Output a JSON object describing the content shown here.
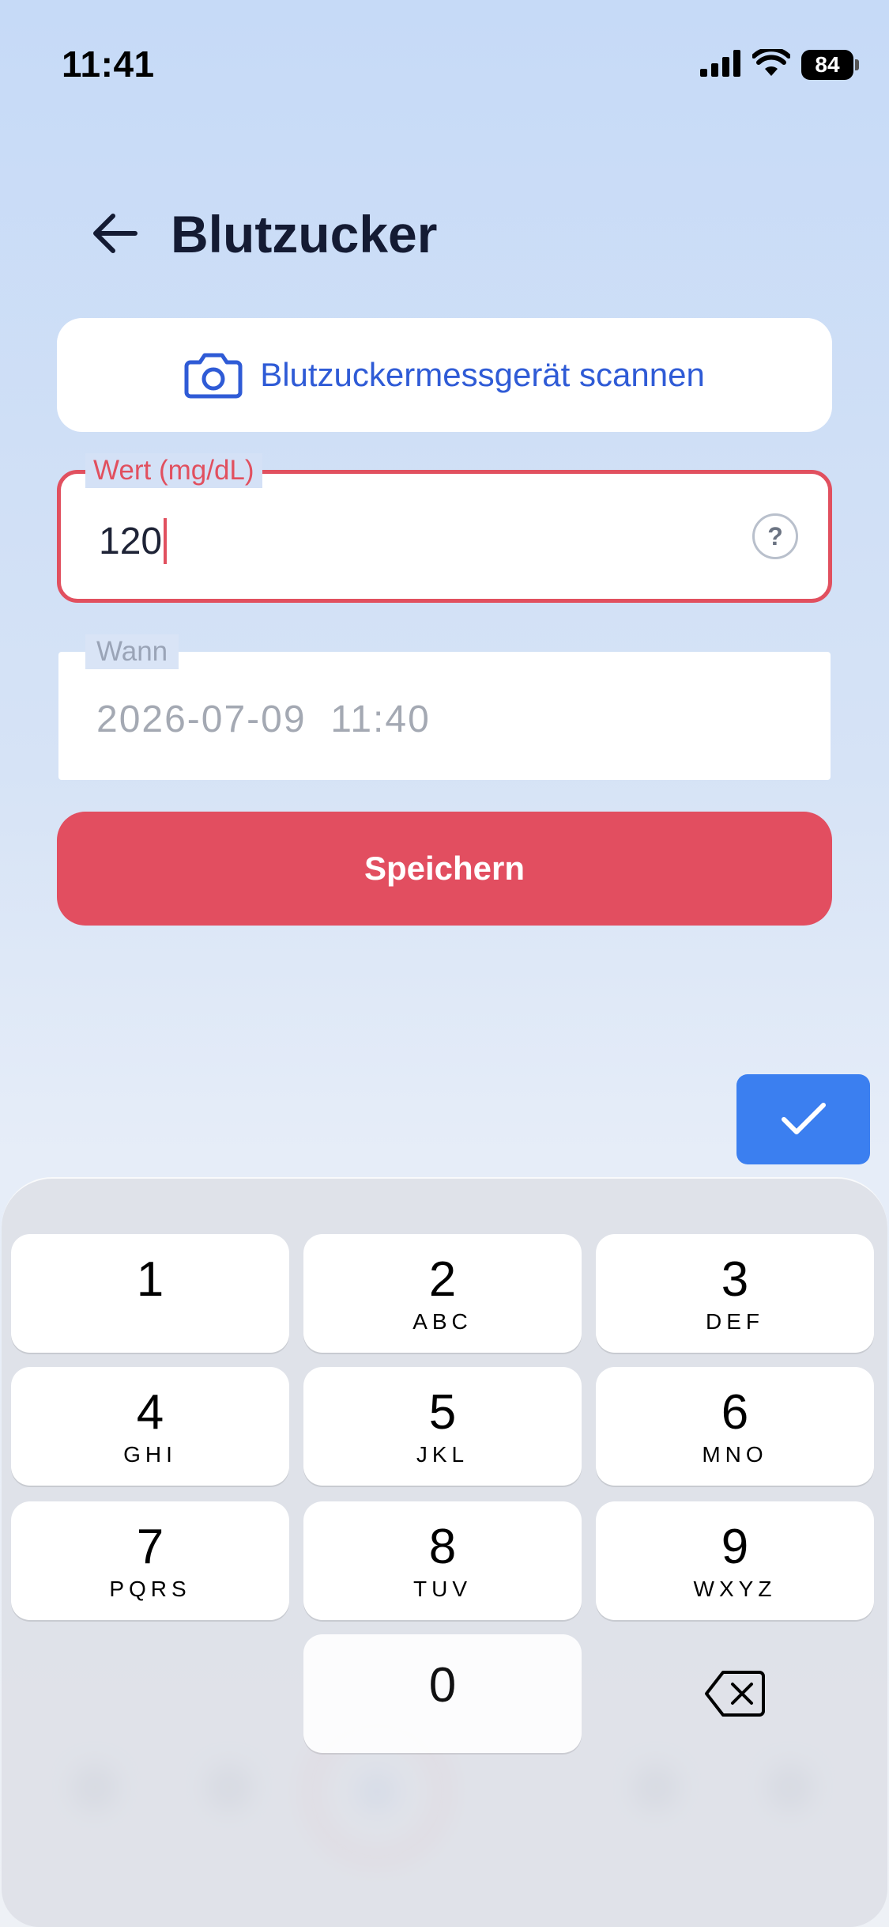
{
  "status_bar": {
    "time": "11:41",
    "battery": "84"
  },
  "header": {
    "title": "Blutzucker",
    "back_icon": "arrow-left-icon"
  },
  "scan": {
    "label": "Blutzuckermessgerät scannen",
    "icon": "camera-icon"
  },
  "value_field": {
    "label": "Wert (mg/dL)",
    "value": "120",
    "help": "?"
  },
  "date_field": {
    "label": "Wann",
    "value": "2026-07-09  11:40"
  },
  "save_button": {
    "label": "Speichern"
  },
  "keyboard": {
    "keys": [
      {
        "digit": "1",
        "letters": ""
      },
      {
        "digit": "2",
        "letters": "ABC"
      },
      {
        "digit": "3",
        "letters": "DEF"
      },
      {
        "digit": "4",
        "letters": "GHI"
      },
      {
        "digit": "5",
        "letters": "JKL"
      },
      {
        "digit": "6",
        "letters": "MNO"
      },
      {
        "digit": "7",
        "letters": "PQRS"
      },
      {
        "digit": "8",
        "letters": "TUV"
      },
      {
        "digit": "9",
        "letters": "WXYZ"
      },
      {
        "digit": "0",
        "letters": ""
      }
    ]
  },
  "colors": {
    "accent_red": "#e24e60",
    "accent_blue": "#3b7ff0",
    "link_blue": "#2f5bd6"
  }
}
